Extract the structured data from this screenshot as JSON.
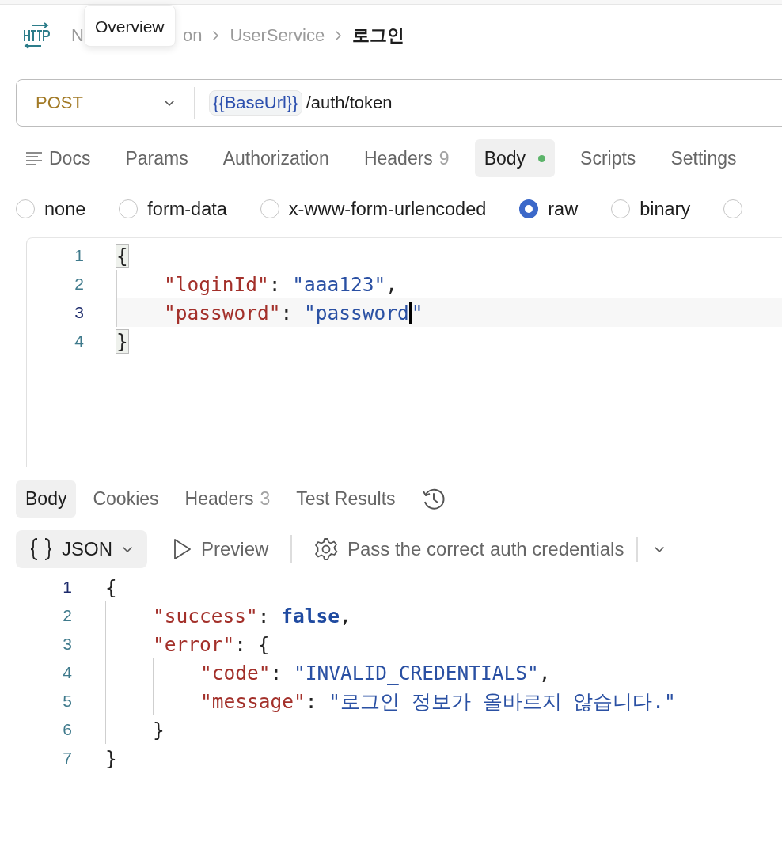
{
  "header": {
    "breadcrumb": [
      {
        "label_start": "N",
        "label_end": "on",
        "current": false
      },
      {
        "label": "UserService",
        "current": false
      },
      {
        "label": "로그인",
        "current": true
      }
    ],
    "tooltip": "Overview"
  },
  "request": {
    "method": "POST",
    "variable": "{{BaseUrl}}",
    "path": "/auth/token"
  },
  "request_tabs": [
    {
      "kind": "docs",
      "label": "Docs",
      "selected": false
    },
    {
      "kind": "tab",
      "label": "Params",
      "selected": false
    },
    {
      "kind": "tab",
      "label": "Authorization",
      "selected": false
    },
    {
      "kind": "tab",
      "label": "Headers",
      "count": "9",
      "selected": false
    },
    {
      "kind": "tab",
      "label": "Body",
      "indicator": true,
      "selected": true
    },
    {
      "kind": "tab",
      "label": "Scripts",
      "selected": false
    },
    {
      "kind": "tab",
      "label": "Settings",
      "selected": false
    }
  ],
  "body_types": [
    {
      "label": "none",
      "selected": false
    },
    {
      "label": "form-data",
      "selected": false
    },
    {
      "label": "x-www-form-urlencoded",
      "selected": false
    },
    {
      "label": "raw",
      "selected": true
    },
    {
      "label": "binary",
      "selected": false
    },
    {
      "selected": false
    }
  ],
  "request_body": {
    "lines": [
      {
        "number": "1",
        "active": false,
        "tokens": [
          {
            "kind": "punct",
            "text": "{",
            "matched": true
          }
        ]
      },
      {
        "number": "2",
        "active": false,
        "tokens": [
          {
            "kind": "key",
            "text": "    \"loginId\""
          },
          {
            "kind": "punct",
            "text": ": "
          },
          {
            "kind": "string",
            "text": "\"aaa123\""
          },
          {
            "kind": "punct",
            "text": ","
          }
        ]
      },
      {
        "number": "3",
        "active": true,
        "tokens": [
          {
            "kind": "key",
            "text": "    \"password\""
          },
          {
            "kind": "punct",
            "text": ": "
          },
          {
            "kind": "string",
            "text": "\"password",
            "cursor_after": true
          },
          {
            "kind": "string",
            "text": "\""
          }
        ]
      },
      {
        "number": "4",
        "active": false,
        "tokens": [
          {
            "kind": "punct",
            "text": "}",
            "matched": true
          }
        ]
      }
    ]
  },
  "response_tabs": [
    {
      "kind": "tab",
      "label": "Body",
      "selected": true
    },
    {
      "kind": "tab",
      "label": "Cookies",
      "selected": false
    },
    {
      "kind": "tab",
      "label": "Headers",
      "count": "3",
      "selected": false
    },
    {
      "kind": "tab",
      "label": "Test Results",
      "selected": false
    },
    {
      "kind": "history",
      "selected": false
    }
  ],
  "response_toolbar": {
    "format": "JSON",
    "preview": "Preview",
    "test": "Pass the correct auth credentials"
  },
  "response_body": {
    "lines": [
      {
        "number": "1",
        "active": true,
        "tokens": [
          {
            "kind": "punct",
            "text": "{"
          }
        ]
      },
      {
        "number": "2",
        "active": false,
        "tokens": [
          {
            "kind": "key",
            "text": "    \"success\""
          },
          {
            "kind": "punct",
            "text": ": "
          },
          {
            "kind": "keyword",
            "text": "false"
          },
          {
            "kind": "punct",
            "text": ","
          }
        ]
      },
      {
        "number": "3",
        "active": false,
        "tokens": [
          {
            "kind": "key",
            "text": "    \"error\""
          },
          {
            "kind": "punct",
            "text": ": {"
          }
        ]
      },
      {
        "number": "4",
        "active": false,
        "tokens": [
          {
            "kind": "key",
            "text": "        \"code\""
          },
          {
            "kind": "punct",
            "text": ": "
          },
          {
            "kind": "string",
            "text": "\"INVALID_CREDENTIALS\""
          },
          {
            "kind": "punct",
            "text": ","
          }
        ]
      },
      {
        "number": "5",
        "active": false,
        "tokens": [
          {
            "kind": "key",
            "text": "        \"message\""
          },
          {
            "kind": "punct",
            "text": ": "
          },
          {
            "kind": "string",
            "text": "\"로그인 정보가 올바르지 않습니다.\""
          }
        ]
      },
      {
        "number": "6",
        "active": false,
        "tokens": [
          {
            "kind": "punct",
            "text": "    }"
          }
        ]
      },
      {
        "number": "7",
        "active": false,
        "tokens": [
          {
            "kind": "punct",
            "text": "}"
          }
        ]
      }
    ]
  }
}
